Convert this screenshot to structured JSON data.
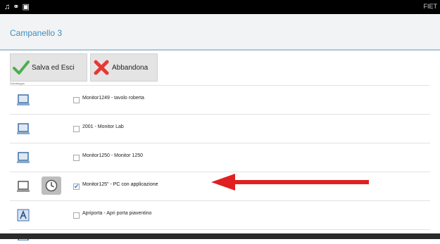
{
  "status_bar": {
    "right_text": "FIET"
  },
  "header": {
    "title": "Campanello 3"
  },
  "toolbar": {
    "save_label": "Salva ed Esci",
    "abandon_label": "Abbandona",
    "tiny_label": "Salvataggio"
  },
  "devices": [
    {
      "label": "Monitor1249 - tavolo roberta",
      "checked": false
    },
    {
      "label": "2001 - Monitor Lab",
      "checked": false
    },
    {
      "label": "Monitor1250 - Monitor 1250",
      "checked": false
    },
    {
      "label": "Monitor125\" - PC con applicazione",
      "checked": true
    },
    {
      "label": "Apriporta - Apri porta piaventino",
      "checked": false
    }
  ],
  "colors": {
    "accent": "#3a8fc1",
    "arrow": "#e02020",
    "check": "#2f7fc9",
    "save_icon": "#4caf50",
    "abandon_icon": "#e53935"
  }
}
